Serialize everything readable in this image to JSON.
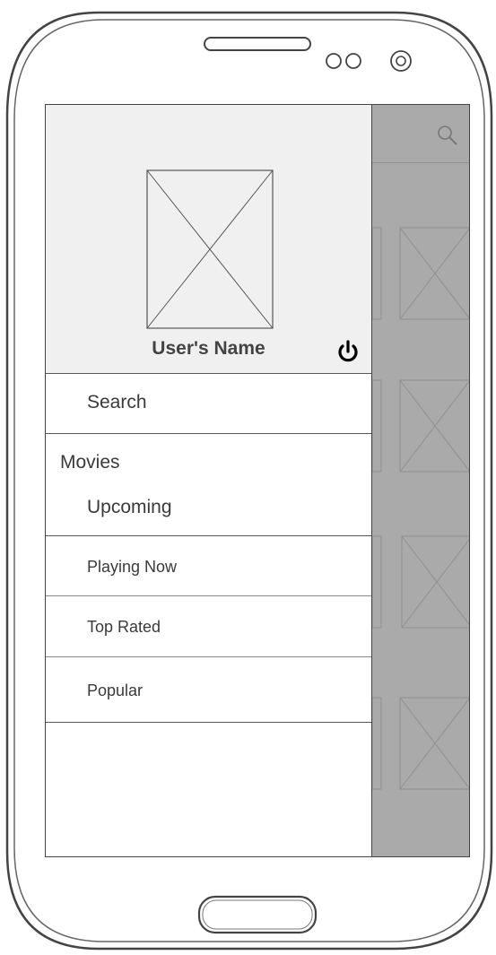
{
  "drawer": {
    "user_name": "User's Name",
    "menu": {
      "search": "Search",
      "group_label": "Movies",
      "upcoming": "Upcoming",
      "playing_now": "Playing Now",
      "top_rated": "Top Rated",
      "popular": "Popular"
    }
  },
  "colors": {
    "overlay": "#aaaaaa",
    "header_bg": "#f0f0f0",
    "text": "#3a3a3a"
  }
}
